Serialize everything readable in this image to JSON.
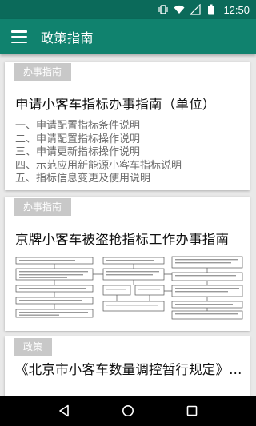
{
  "status_bar": {
    "time": "12:50"
  },
  "app_bar": {
    "title": "政策指南"
  },
  "cards": [
    {
      "tag": "办事指南",
      "title": "申请小客车指标办事指南（单位）",
      "items": [
        "一、申请配置指标条件说明",
        "二、申请配置指标操作说明",
        "三、申请更新指标操作说明",
        "四、示范应用新能源小客车指标说明",
        "五、指标信息变更及使用说明"
      ]
    },
    {
      "tag": "办事指南",
      "title": "京牌小客车被盗抢指标工作办事指南"
    },
    {
      "tag": "政策",
      "title": "《北京市小客车数量调控暂行规定》..."
    }
  ],
  "colors": {
    "status_bar": "#0b6a5a",
    "app_bar": "#10826e",
    "tag_bg": "#c8c8c8",
    "background": "#e9e9e9"
  },
  "icons": [
    "vibrate-icon",
    "wifi-icon",
    "signal-icon",
    "battery-icon",
    "menu-icon",
    "back-icon",
    "home-icon",
    "recents-icon"
  ]
}
